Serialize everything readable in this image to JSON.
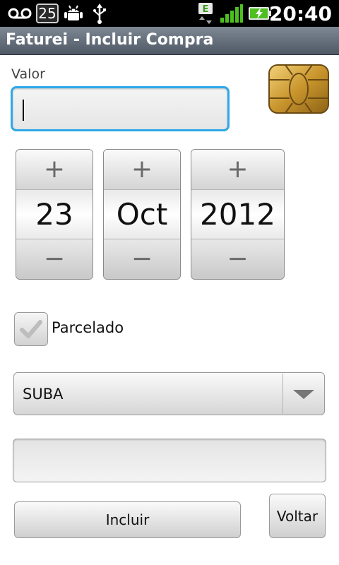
{
  "status_bar": {
    "notification_count": "25",
    "network_type": "E",
    "time": "20:40",
    "icons": [
      "voicemail-icon",
      "notification-badge",
      "android-debug-icon",
      "usb-icon",
      "data-edge-icon",
      "signal-icon",
      "battery-charging-icon"
    ]
  },
  "title_bar": {
    "title": "Faturei - Incluir Compra"
  },
  "form": {
    "valor_label": "Valor",
    "valor_value": "",
    "card_icon": "card-chip-icon",
    "date": {
      "day": "23",
      "month": "Oct",
      "year": "2012",
      "increment_symbol": "+",
      "decrement_symbol": "−"
    },
    "parcelado": {
      "label": "Parcelado",
      "checked": true
    },
    "category": {
      "selected": "SUBA"
    },
    "description_value": "",
    "buttons": {
      "incluir": "Incluir",
      "voltar": "Voltar"
    }
  },
  "colors": {
    "status_bar_bg": "#000000",
    "title_bar_bg": "#5e6875",
    "focus_border": "#2ea9e8",
    "signal_green": "#4dc01f",
    "chip_gold": "#c9952d"
  }
}
